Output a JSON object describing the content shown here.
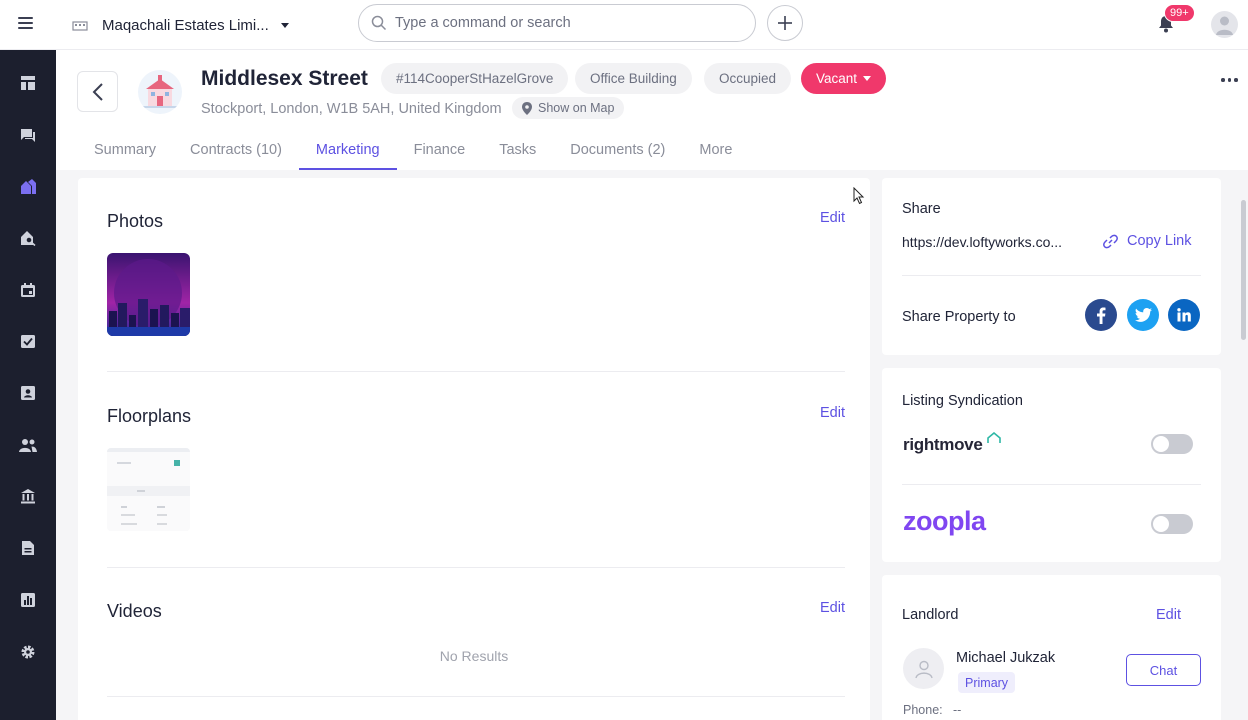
{
  "topbar": {
    "company_name": "Maqachali Estates Limi...",
    "search_placeholder": "Type a command or search",
    "notification_badge": "99+"
  },
  "sidebar": {
    "items": [
      {
        "icon": "dashboard-icon",
        "active": false
      },
      {
        "icon": "chat-icon",
        "active": false
      },
      {
        "icon": "properties-icon",
        "active": true
      },
      {
        "icon": "property-search-icon",
        "active": false
      },
      {
        "icon": "calendar-icon",
        "active": false
      },
      {
        "icon": "tasks-icon",
        "active": false
      },
      {
        "icon": "contacts-icon",
        "active": false
      },
      {
        "icon": "people-icon",
        "active": false
      },
      {
        "icon": "bank-icon",
        "active": false
      },
      {
        "icon": "document-icon",
        "active": false
      },
      {
        "icon": "reports-icon",
        "active": false
      },
      {
        "icon": "settings-icon",
        "active": false
      }
    ]
  },
  "property": {
    "title": "Middlesex Street",
    "chips": [
      "#114CooperStHazelGrove",
      "Office Building",
      "Occupied"
    ],
    "status": "Vacant",
    "address": "Stockport, London, W1B 5AH, United Kingdom",
    "show_map": "Show on Map"
  },
  "tabs": [
    {
      "label": "Summary",
      "active": false
    },
    {
      "label": "Contracts (10)",
      "active": false
    },
    {
      "label": "Marketing",
      "active": true
    },
    {
      "label": "Finance",
      "active": false
    },
    {
      "label": "Tasks",
      "active": false
    },
    {
      "label": "Documents (2)",
      "active": false
    },
    {
      "label": "More",
      "active": false
    }
  ],
  "marketing": {
    "photos_title": "Photos",
    "floorplans_title": "Floorplans",
    "videos_title": "Videos",
    "edit_label": "Edit",
    "no_results": "No Results"
  },
  "share": {
    "title": "Share",
    "url": "https://dev.loftyworks.co...",
    "copy_label": "Copy Link",
    "share_to_label": "Share Property to",
    "networks": [
      "facebook",
      "twitter",
      "linkedin"
    ]
  },
  "syndication": {
    "title": "Listing Syndication",
    "portals": [
      {
        "name": "rightmove",
        "enabled": false
      },
      {
        "name": "zoopla",
        "enabled": false
      }
    ]
  },
  "landlord": {
    "title": "Landlord",
    "edit_label": "Edit",
    "name": "Michael Jukzak",
    "badge": "Primary",
    "chat_label": "Chat",
    "phone_label": "Phone:",
    "phone_value": "--"
  },
  "colors": {
    "accent": "#5d51e2",
    "vacant": "#f0386b",
    "sidebar": "#1c1f2e",
    "facebook": "#2a4a8f",
    "twitter": "#1da1f2",
    "linkedin": "#0a66c2",
    "zoopla": "#8046f1"
  }
}
